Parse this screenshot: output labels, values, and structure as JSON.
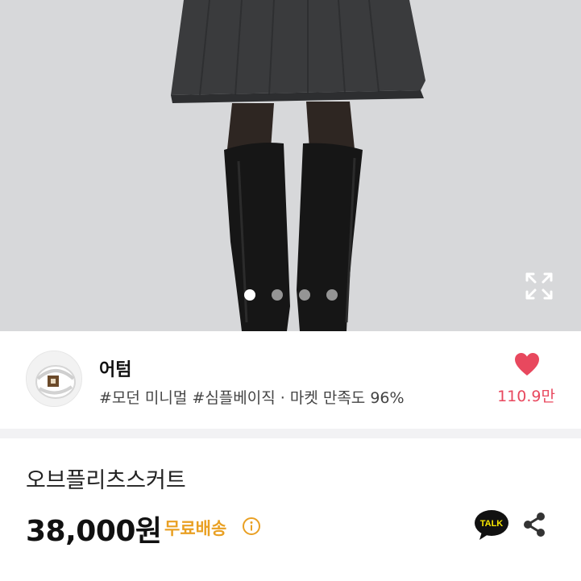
{
  "seller": {
    "name": "어텀",
    "tags": "#모던 미니멀 #심플베이직 · 마켓 만족도 96%",
    "likes": "110.9만"
  },
  "product": {
    "name": "오브플리츠스커트",
    "price": "38,000원",
    "shipping": "무료배송"
  },
  "gallery": {
    "total_images": 4,
    "current_index": 1
  },
  "buttons": {
    "talk_label": "TALK"
  },
  "colors": {
    "accent_like": "#e8485e",
    "shipping": "#e9a023",
    "talk_bg": "#111111"
  },
  "icons": {
    "expand": "expand-icon",
    "info": "info-icon",
    "share": "share-icon",
    "like": "heart-icon"
  }
}
